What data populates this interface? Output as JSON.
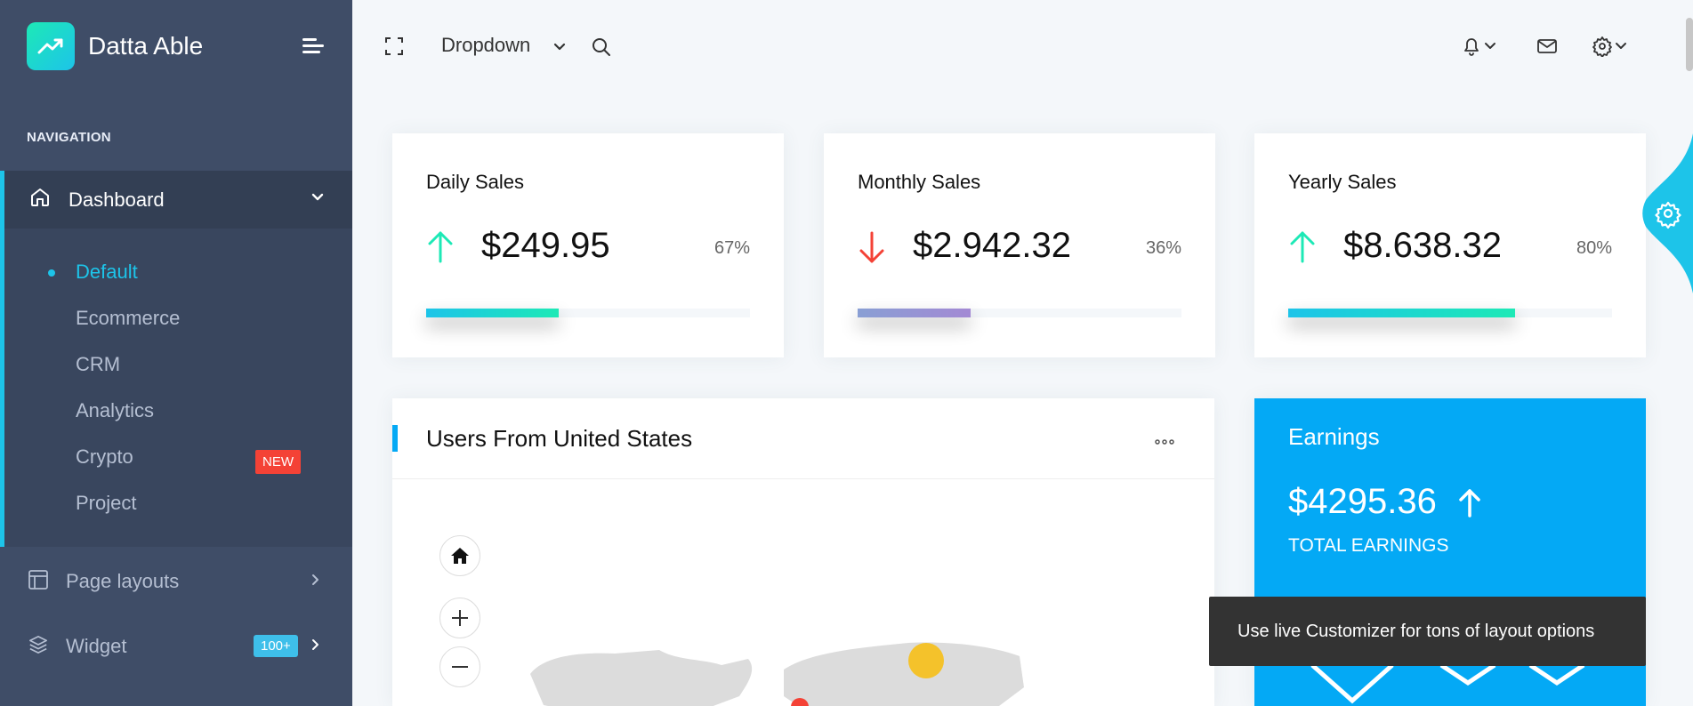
{
  "brand": {
    "name": "Datta Able"
  },
  "sidebar": {
    "caption": "NAVIGATION",
    "active_item": {
      "label": "Dashboard"
    },
    "submenu": [
      {
        "label": "Default"
      },
      {
        "label": "Ecommerce"
      },
      {
        "label": "CRM"
      },
      {
        "label": "Analytics"
      },
      {
        "label": "Crypto",
        "badge": "NEW"
      },
      {
        "label": "Project"
      }
    ],
    "items": [
      {
        "label": "Page layouts"
      },
      {
        "label": "Widget",
        "badge": "100+"
      }
    ]
  },
  "header": {
    "dropdown_label": "Dropdown"
  },
  "stats": [
    {
      "title": "Daily Sales",
      "value": "$249.95",
      "percent": "67%",
      "progress": 0.41,
      "trend": "up",
      "bar_color": "#1de9b6"
    },
    {
      "title": "Monthly Sales",
      "value": "$2.942.32",
      "percent": "36%",
      "progress": 0.35,
      "trend": "down",
      "bar_color": "#a389d4"
    },
    {
      "title": "Yearly Sales",
      "value": "$8.638.32",
      "percent": "80%",
      "progress": 0.7,
      "trend": "up",
      "bar_color": "#1de9b6"
    }
  ],
  "users_card": {
    "title": "Users From United States"
  },
  "earnings": {
    "title": "Earnings",
    "value": "$4295.36",
    "label": "TOTAL EARNINGS"
  },
  "toast": {
    "text": "Use live Customizer for tons of layout options"
  },
  "colors": {
    "sidebar": "#3f4d67",
    "accent": "#1dc4e9",
    "earnings_bg": "#04a9f5",
    "up": "#1de9b6",
    "down": "#f44236"
  }
}
